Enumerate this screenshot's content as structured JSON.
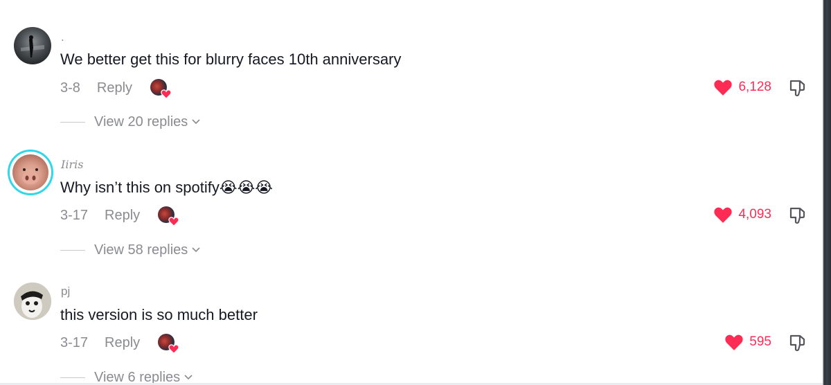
{
  "comments": [
    {
      "username": ".",
      "text": "We better get this for blurry faces 10th anniversary",
      "date": "3-8",
      "reply_label": "Reply",
      "likes": "6,128",
      "view_replies": "View 20 replies"
    },
    {
      "username": "Iiris",
      "text": "Why isn’t this on spotify😭😭😭",
      "date": "3-17",
      "reply_label": "Reply",
      "likes": "4,093",
      "view_replies": "View 58 replies"
    },
    {
      "username": "pj",
      "text": "this version is so much better",
      "date": "3-17",
      "reply_label": "Reply",
      "likes": "595",
      "view_replies": "View 6 replies"
    }
  ],
  "colors": {
    "like": "#fe2c55",
    "muted": "#8a8b91",
    "text": "#161823",
    "story_ring": "#2fd7e8"
  },
  "icons": {
    "like": "heart-icon",
    "dislike": "thumbs-down-icon",
    "expand": "chevron-down-icon",
    "creator_liked": "creator-liked-avatar"
  }
}
